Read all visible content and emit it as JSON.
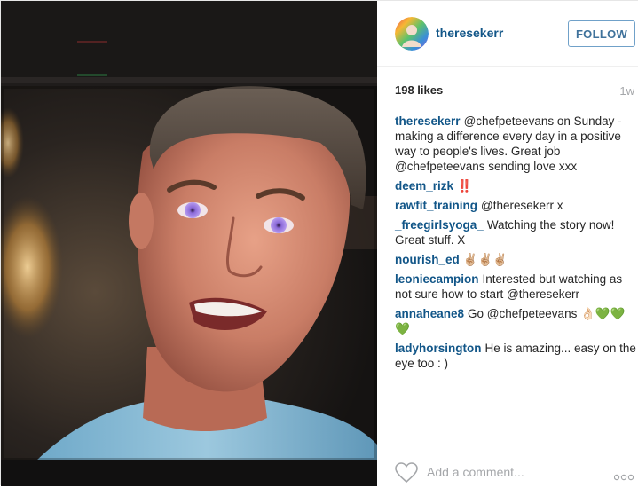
{
  "photo": {
    "subject": "Television screen showing a close-up of a smiling man with short grey-brown hair and violet eyes"
  },
  "header": {
    "username": "theresekerr",
    "follow_label": "FOLLOW",
    "avatar_icon": "user-avatar-icon"
  },
  "stats": {
    "likes": "198 likes",
    "timestamp": "1w"
  },
  "comments": [
    {
      "user": "theresekerr",
      "text": "@chefpeteevans on Sunday - making a difference every day in a positive way to people's lives. Great job @chefpeteevans sending love xxx"
    },
    {
      "user": "deem_rizk",
      "text": "‼️"
    },
    {
      "user": "rawfit_training",
      "text": "@theresekerr x"
    },
    {
      "user": "_freegirlsyoga_",
      "text": "Watching the story now! Great stuff. X"
    },
    {
      "user": "nourish_ed",
      "text": "✌🏼✌🏼✌🏼"
    },
    {
      "user": "leoniecampion",
      "text": "Interested but watching as not sure how to start @theresekerr"
    },
    {
      "user": "annaheane8",
      "text": "Go @chefpeteevans 👌🏻💚💚💚"
    },
    {
      "user": "ladyhorsington",
      "text": "He is amazing... easy on the eye too : )"
    }
  ],
  "footer": {
    "comment_placeholder": "Add a comment...",
    "like_icon": "heart-icon",
    "more_icon": "more-options-icon"
  },
  "colors": {
    "username": "#125688",
    "follow_text": "#3f729b",
    "follow_border": "#70a1c9",
    "muted": "#a5a7aa",
    "border": "#efefef"
  }
}
